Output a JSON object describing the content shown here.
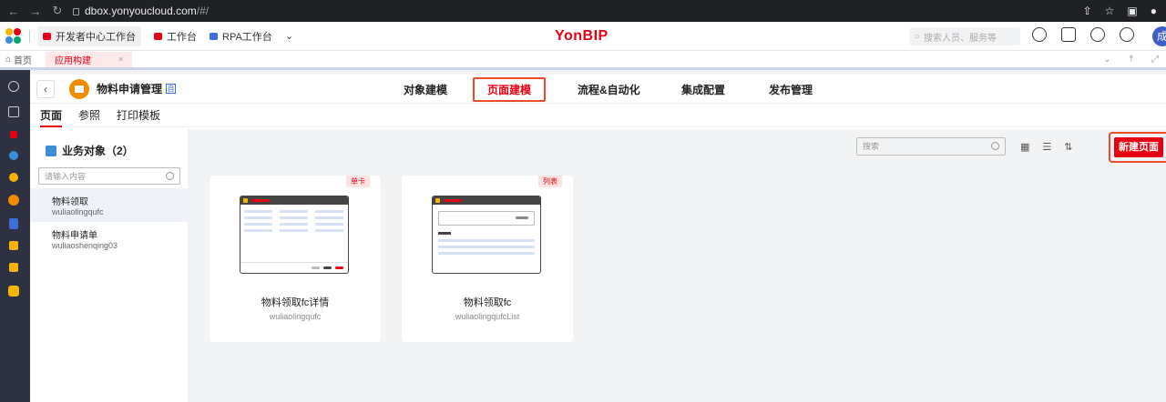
{
  "browser": {
    "url_host": "dbox.yonyoucloud.com",
    "url_path": "/#/"
  },
  "header": {
    "links": [
      "开发者中心工作台",
      "工作台",
      "RPA工作台"
    ],
    "brand": "YonBIP",
    "search_placeholder": "搜索人员、服务等",
    "avatar_text": "成"
  },
  "tabs": {
    "home": "首页",
    "active": "应用构建",
    "close": "×"
  },
  "object": {
    "title": "物料申请管理",
    "badge": "自"
  },
  "nav": [
    "对象建模",
    "页面建模",
    "流程&自动化",
    "集成配置",
    "发布管理"
  ],
  "subtabs": [
    "页面",
    "参照",
    "打印模板"
  ],
  "left_panel": {
    "title": "业务对象（2）",
    "search_placeholder": "请输入内容",
    "items": [
      {
        "name": "物料领取",
        "code": "wuliaolingqufc"
      },
      {
        "name": "物料申请单",
        "code": "wuliaoshenqing03"
      }
    ]
  },
  "content": {
    "search_placeholder": "搜索",
    "new_button": "新建页面",
    "cards": [
      {
        "tag": "单卡",
        "name": "物料领取fc详情",
        "code": "wuliaolingqufc"
      },
      {
        "tag": "列表",
        "name": "物料领取fc",
        "code": "wuliaolingqufcList"
      }
    ]
  },
  "colors": {
    "brand": "#e60012",
    "rail": "#2d3142",
    "content_bg": "#f2f3f5"
  }
}
